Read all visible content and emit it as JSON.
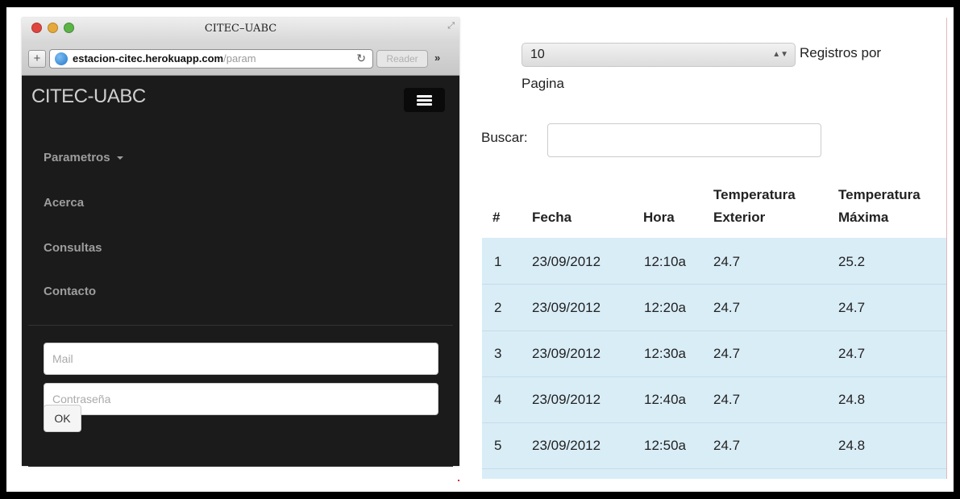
{
  "browser": {
    "window_title": "CITEC–UABC",
    "url_host": "estacion-citec.herokuapp.com",
    "url_path": "/param",
    "reader_label": "Reader",
    "add_label": "+",
    "more_label": "»",
    "reload_label": "↻"
  },
  "nav": {
    "brand": "CITEC-UABC",
    "items": [
      {
        "label": "Parametros"
      },
      {
        "label": "Acerca"
      },
      {
        "label": "Consultas"
      },
      {
        "label": "Contacto"
      }
    ]
  },
  "login": {
    "mail_placeholder": "Mail",
    "password_placeholder": "Contraseña",
    "ok_label": "OK"
  },
  "controls": {
    "page_size": "10",
    "page_size_label": "Registros por",
    "page_size_label_2": "Pagina",
    "search_label": "Buscar:",
    "search_value": ""
  },
  "table": {
    "headers": {
      "num": "#",
      "fecha": "Fecha",
      "hora": "Hora",
      "temp_ext_1": "Temperatura",
      "temp_ext_2": "Exterior",
      "temp_max_1": "Temperatura",
      "temp_max_2": "Máxima"
    },
    "rows": [
      {
        "num": "1",
        "fecha": "23/09/2012",
        "hora": "12:10a",
        "temp_ext": "24.7",
        "temp_max": "25.2"
      },
      {
        "num": "2",
        "fecha": "23/09/2012",
        "hora": "12:20a",
        "temp_ext": "24.7",
        "temp_max": "24.7"
      },
      {
        "num": "3",
        "fecha": "23/09/2012",
        "hora": "12:30a",
        "temp_ext": "24.7",
        "temp_max": "24.7"
      },
      {
        "num": "4",
        "fecha": "23/09/2012",
        "hora": "12:40a",
        "temp_ext": "24.7",
        "temp_max": "24.8"
      },
      {
        "num": "5",
        "fecha": "23/09/2012",
        "hora": "12:50a",
        "temp_ext": "24.7",
        "temp_max": "24.8"
      }
    ]
  }
}
